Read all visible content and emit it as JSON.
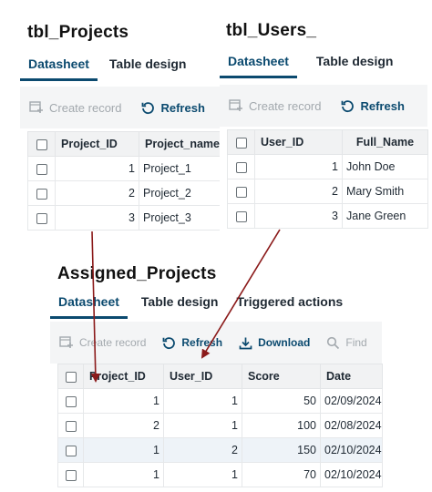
{
  "projects_panel": {
    "title": "tbl_Projects",
    "tabs": [
      "Datasheet",
      "Table design"
    ],
    "toolbar": {
      "create": "Create record",
      "refresh": "Refresh"
    },
    "columns": [
      "Project_ID",
      "Project_name"
    ],
    "rows": [
      {
        "id": "1",
        "name": "Project_1"
      },
      {
        "id": "2",
        "name": "Project_2"
      },
      {
        "id": "3",
        "name": "Project_3"
      }
    ]
  },
  "users_panel": {
    "title": "tbl_Users_",
    "tabs": [
      "Datasheet",
      "Table design"
    ],
    "toolbar": {
      "create": "Create record",
      "refresh": "Refresh"
    },
    "columns": [
      "User_ID",
      "Full_Name"
    ],
    "rows": [
      {
        "id": "1",
        "name": "John Doe"
      },
      {
        "id": "2",
        "name": "Mary Smith"
      },
      {
        "id": "3",
        "name": "Jane Green"
      }
    ]
  },
  "assigned_panel": {
    "title": "Assigned_Projects",
    "tabs": [
      "Datasheet",
      "Table design",
      "Triggered actions"
    ],
    "toolbar": {
      "create": "Create record",
      "refresh": "Refresh",
      "download": "Download",
      "find": "Find"
    },
    "columns": [
      "Project_ID",
      "User_ID",
      "Score",
      "Date"
    ],
    "rows": [
      {
        "project_id": "1",
        "user_id": "1",
        "score": "50",
        "date": "02/09/2024"
      },
      {
        "project_id": "2",
        "user_id": "1",
        "score": "100",
        "date": "02/08/2024"
      },
      {
        "project_id": "1",
        "user_id": "2",
        "score": "150",
        "date": "02/10/2024"
      },
      {
        "project_id": "1",
        "user_id": "1",
        "score": "70",
        "date": "02/10/2024"
      }
    ]
  },
  "colors": {
    "accent": "#0b4a6f",
    "arrow": "#8b1a1a",
    "disabled": "#a3a9ae"
  }
}
